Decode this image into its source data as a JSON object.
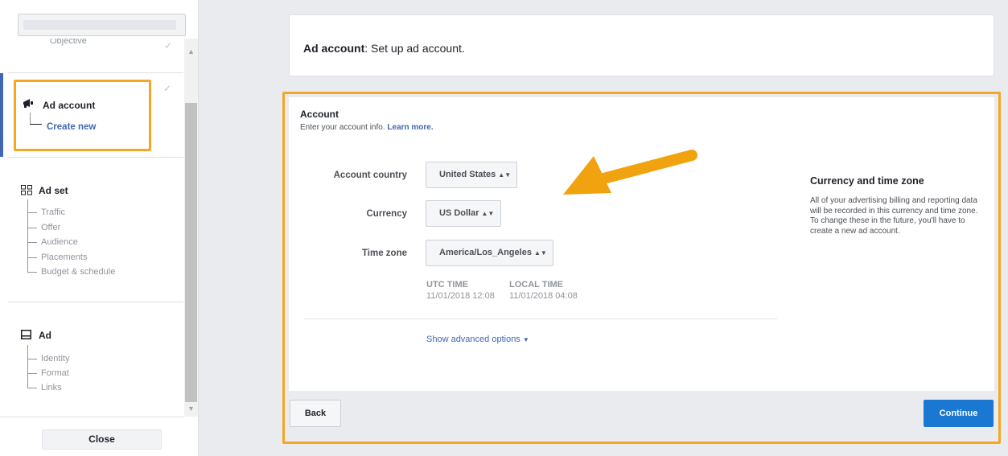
{
  "sidebar": {
    "objective_label": "Objective",
    "objective_check": "✓",
    "ad_account": {
      "title": "Ad account",
      "child": "Create new",
      "check": "✓"
    },
    "ad_set": {
      "title": "Ad set",
      "items": [
        "Traffic",
        "Offer",
        "Audience",
        "Placements",
        "Budget & schedule"
      ]
    },
    "ad": {
      "title": "Ad",
      "items": [
        "Identity",
        "Format",
        "Links"
      ]
    },
    "close_label": "Close"
  },
  "header": {
    "title_bold": "Ad account",
    "title_rest": ": Set up ad account."
  },
  "account": {
    "title": "Account",
    "subtitle": "Enter your account info. ",
    "learn_more": "Learn more.",
    "fields": {
      "country_label": "Account country",
      "country_value": "United States",
      "currency_label": "Currency",
      "currency_value": "US Dollar",
      "timezone_label": "Time zone",
      "timezone_value": "America/Los_Angeles"
    },
    "utc_time_label": "UTC TIME",
    "utc_time_value": "11/01/2018 12:08",
    "local_time_label": "LOCAL TIME",
    "local_time_value": "11/01/2018 04:08",
    "advanced_options": "Show advanced options"
  },
  "info": {
    "title": "Currency and time zone",
    "body": "All of your advertising billing and reporting data will be recorded in this currency and time zone. To change these in the future, you'll have to create a new ad account."
  },
  "footer": {
    "back_label": "Back",
    "continue_label": "Continue"
  },
  "colors": {
    "highlight": "#f5a623",
    "primary": "#1a77d2",
    "link": "#4267b2"
  }
}
